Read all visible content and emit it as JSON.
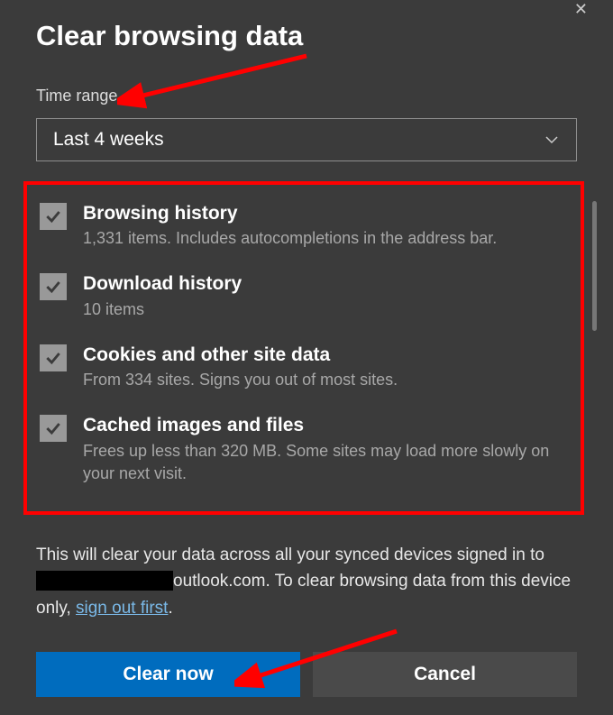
{
  "dialog": {
    "title": "Clear browsing data",
    "close_glyph": "✕"
  },
  "time_range": {
    "label": "Time range",
    "selected": "Last 4 weeks"
  },
  "options": [
    {
      "title": "Browsing history",
      "desc": "1,331 items. Includes autocompletions in the address bar.",
      "checked": true
    },
    {
      "title": "Download history",
      "desc": "10 items",
      "checked": true
    },
    {
      "title": "Cookies and other site data",
      "desc": "From 334 sites. Signs you out of most sites.",
      "checked": true
    },
    {
      "title": "Cached images and files",
      "desc": "Frees up less than 320 MB. Some sites may load more slowly on your next visit.",
      "checked": true
    }
  ],
  "footnote": {
    "pre": "This will clear your data across all your synced devices signed in to ",
    "email_suffix": "outlook.com",
    "mid": ". To clear browsing data from this device only, ",
    "link": "sign out first",
    "post": "."
  },
  "buttons": {
    "primary": "Clear now",
    "secondary": "Cancel"
  }
}
